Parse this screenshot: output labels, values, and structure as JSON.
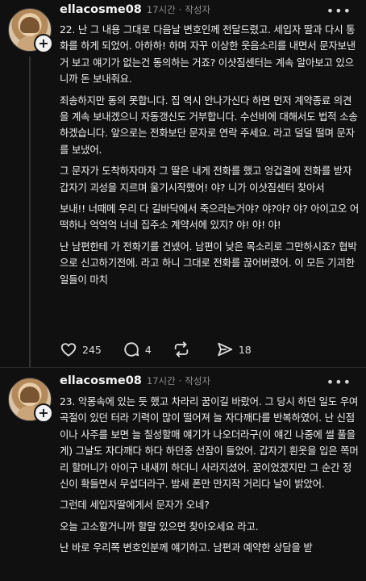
{
  "posts": [
    {
      "username": "ellacosme08",
      "time": "17시간",
      "author_tag": "작성자",
      "paragraphs": [
        "22. 난 그 내용 그대로 다음날 변호인께 전달드렸고. 세입자 딸과 다시 통화를 하게 되었어. 아하하! 하며 자꾸 이상한 웃음소리를 내면서 문자보낸거 보고 얘기가 없는건 동의하는 거죠? 이샷짐센터는 계속 알아보고 있으니까 돈 보내줘요.",
        "죄송하지만 동의 못합니다. 집 역시 안나가신다 하면 먼저 계약종료 의견을 계속 보내겠으니 자동갱신도 거부합니다. 수선비에 대해서도 법적 소송하겠습니다. 앞으로는 전화보단 문자로 연락 주세요. 라고 덜덜 떨며 문자를 보냈어.",
        "그 문자가 도착하자마자 그 딸은 내게 전화를 했고 엉겁결에 전화를 받자 갑자기 괴성을 지르며 울기시작했어! 야? 니가 이샷짐센터 찾아서",
        "보내!! 너때메 우리 다 길바닥에서 죽으라는거야? 야?야? 야? 아이고오 어떡하나 억억억 너네 집주소 계약서에 있지? 야! 야! 야!",
        "난 남편한테 가 전화기를 건넸어. 남편이 낮은 목소리로 그만하시죠? 협박으로 신고하기전에. 라고 하니 그대로 전화를 끊어버렸어. 이 모든 기괴한 일들이 마치"
      ],
      "likes": "245",
      "comments": "4",
      "shares": "18"
    },
    {
      "username": "ellacosme08",
      "time": "17시간",
      "author_tag": "작성자",
      "paragraphs": [
        "23. 악몽속에 있는 듯 했고 차라리 꿈이길 바랐어. 그 당시 하던 일도 우여곡절이 있던 터라 기력이 많이 떨어져 늘 자다깨다를 반복하였어. 난 신점이나 사주를 보면 늘 칠성할매 얘기가 나오더라구(이 얘긴 나중에 썰 풀을게) 그날도 자다깨다 하다 하던중 선잠이 들었어. 갑자기 흰옷을 입은 쪽머리 할머니가 아이구 내새끼 하더니 사라지셨어. 꿈이었겠지만 그 순간 정신이 확들면서 무섭더라구. 밤새 폰만 만지작 거리다 날이 밝았어.",
        "그런데 세입자딸에게서 문자가 오네?",
        "오늘 고소할거니까 할말 있으면 찾아오세요 라고.",
        "난 바로 우리쪽 변호인분께 얘기하고. 남편과 예약한 상담을 받"
      ]
    }
  ]
}
